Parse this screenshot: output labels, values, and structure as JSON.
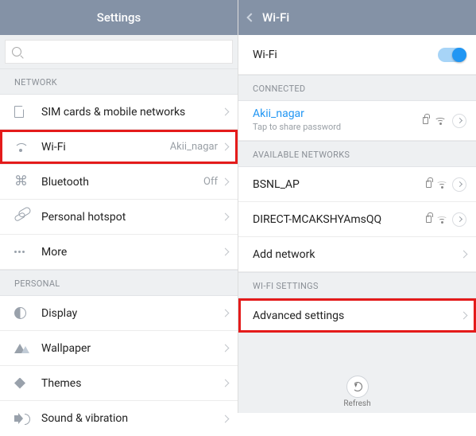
{
  "left": {
    "title": "Settings",
    "sections": {
      "network": {
        "header": "NETWORK",
        "sim": "SIM cards & mobile networks",
        "wifi": "Wi-Fi",
        "wifi_value": "Akii_nagar",
        "bluetooth": "Bluetooth",
        "bluetooth_value": "Off",
        "hotspot": "Personal hotspot",
        "more": "More"
      },
      "personal": {
        "header": "PERSONAL",
        "display": "Display",
        "wallpaper": "Wallpaper",
        "themes": "Themes",
        "sound": "Sound & vibration"
      }
    }
  },
  "right": {
    "title": "Wi-Fi",
    "master_label": "Wi-Fi",
    "master_on": true,
    "connected_header": "CONNECTED",
    "connected": {
      "ssid": "Akii_nagar",
      "sub": "Tap to share password"
    },
    "available_header": "AVAILABLE NETWORKS",
    "networks": {
      "n0": "BSNL_AP",
      "n1": "DIRECT-MCAKSHYAmsQQ"
    },
    "add": "Add network",
    "settings_header": "WI-FI SETTINGS",
    "advanced": "Advanced settings",
    "refresh": "Refresh"
  }
}
